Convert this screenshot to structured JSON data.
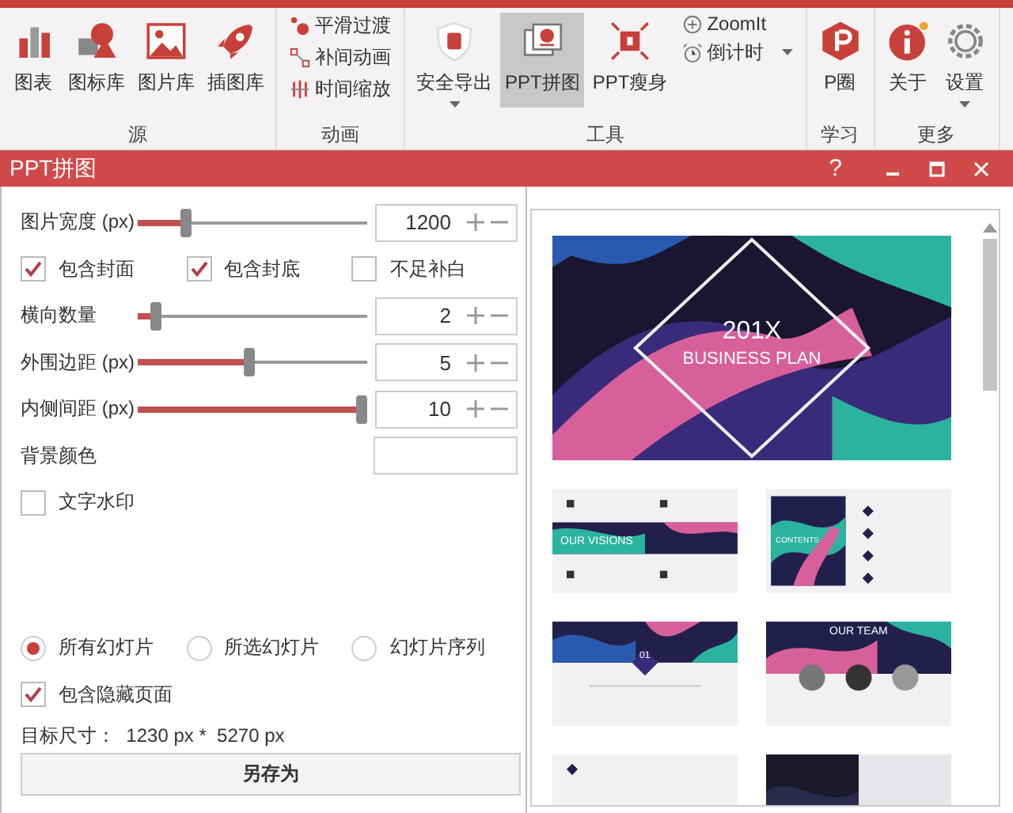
{
  "ribbon": {
    "groups": [
      {
        "label": "源",
        "items": [
          {
            "kind": "large",
            "label": "图表",
            "selected": false,
            "dropdown": false
          },
          {
            "kind": "large",
            "label": "图标库",
            "selected": false,
            "dropdown": false
          },
          {
            "kind": "large",
            "label": "图片库",
            "selected": false,
            "dropdown": false
          },
          {
            "kind": "large",
            "label": "插图库",
            "selected": false,
            "dropdown": false
          }
        ]
      },
      {
        "label": "动画",
        "items": [
          {
            "kind": "small",
            "label": "平滑过渡",
            "dropdown": false
          },
          {
            "kind": "small",
            "label": "补间动画",
            "dropdown": false
          },
          {
            "kind": "small",
            "label": "时间缩放",
            "dropdown": false
          }
        ]
      },
      {
        "label": "工具",
        "items": [
          {
            "kind": "large",
            "label": "安全导出",
            "selected": false,
            "dropdown": true
          },
          {
            "kind": "large",
            "label": "PPT拼图",
            "selected": true,
            "dropdown": false
          },
          {
            "kind": "large",
            "label": "PPT瘦身",
            "selected": false,
            "dropdown": false
          },
          {
            "kind": "small",
            "label": "ZoomIt",
            "dropdown": false
          },
          {
            "kind": "small",
            "label": "倒计时",
            "dropdown": true
          }
        ]
      },
      {
        "label": "学习",
        "items": [
          {
            "kind": "large",
            "label": "P圈",
            "selected": false,
            "dropdown": false
          }
        ]
      },
      {
        "label": "更多",
        "items": [
          {
            "kind": "large",
            "label": "关于",
            "selected": false,
            "dropdown": false
          },
          {
            "kind": "large",
            "label": "设置",
            "selected": false,
            "dropdown": true
          }
        ]
      }
    ]
  },
  "dialog": {
    "title": "PPT拼图",
    "help": "?"
  },
  "settings": {
    "width": {
      "label": "图片宽度 (px)",
      "level": 0.2,
      "value": "1200"
    },
    "options": [
      {
        "label": "包含封面",
        "checked": true
      },
      {
        "label": "包含封底",
        "checked": true
      },
      {
        "label": "不足补白",
        "checked": false
      }
    ],
    "sliders": [
      {
        "label": "横向数量",
        "level": 0.06,
        "value": "2"
      },
      {
        "label": "外围边距 (px)",
        "level": 0.49,
        "value": "5"
      },
      {
        "label": "内侧间距 (px)",
        "level": 1.0,
        "value": "10"
      }
    ],
    "background": {
      "label": "背景颜色"
    },
    "watermark": {
      "label": "文字水印",
      "checked": false
    },
    "scope": [
      {
        "label": "所有幻灯片",
        "selected": true
      },
      {
        "label": "所选幻灯片",
        "selected": false
      },
      {
        "label": "幻灯片序列",
        "selected": false
      }
    ],
    "hidden_pages": {
      "label": "包含隐藏页面",
      "checked": true
    },
    "target_size": "目标尺寸：  1230 px *  5270 px",
    "save_button": "另存为"
  },
  "preview": {
    "slides": [
      {
        "kind": "cover",
        "title": "201X",
        "subtitle": "BUSINESS PLAN"
      },
      {
        "kind": "banner",
        "title": "OUR VISIONS"
      },
      {
        "kind": "contents",
        "title": "CONTENTS"
      },
      {
        "kind": "section",
        "title": "01"
      },
      {
        "kind": "team",
        "title": "OUR TEAM"
      },
      {
        "kind": "plain"
      },
      {
        "kind": "dark"
      }
    ]
  }
}
